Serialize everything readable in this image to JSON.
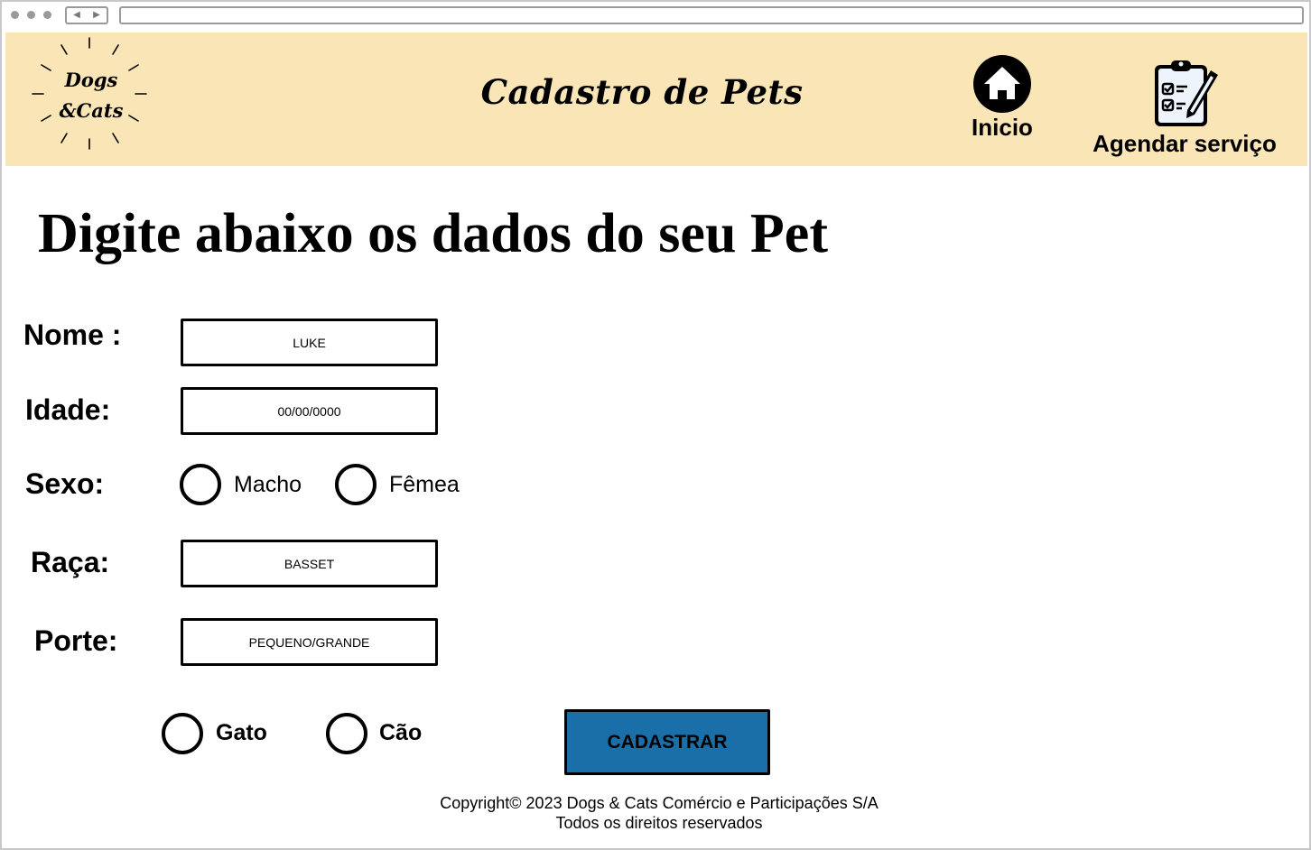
{
  "header": {
    "logo_line1": "Dogs",
    "logo_line2": "&Cats",
    "title": "Cadastro de Pets",
    "nav": [
      {
        "label": "Inicio",
        "icon": "home-icon"
      },
      {
        "label": "Agendar serviço",
        "icon": "clipboard-checklist-icon"
      }
    ]
  },
  "form": {
    "heading": "Digite abaixo os dados do seu Pet",
    "nome": {
      "label": "Nome :",
      "value": "LUKE"
    },
    "idade": {
      "label": "Idade:",
      "value": "00/00/0000"
    },
    "sexo": {
      "label": "Sexo:",
      "options": [
        "Macho",
        "Fêmea"
      ]
    },
    "raca": {
      "label": "Raça:",
      "value": "BASSET"
    },
    "porte": {
      "label": "Porte:",
      "value": "PEQUENO/GRANDE"
    },
    "especie": {
      "options": [
        "Gato",
        "Cão"
      ]
    },
    "submit_label": "CADASTRAR"
  },
  "footer": {
    "line1": "Copyright© 2023 Dogs & Cats Comércio e Participações S/A",
    "line2": "Todos os direitos reservados"
  },
  "colors": {
    "header_bg": "#f9e5b5",
    "button_bg": "#1a6fa8"
  }
}
